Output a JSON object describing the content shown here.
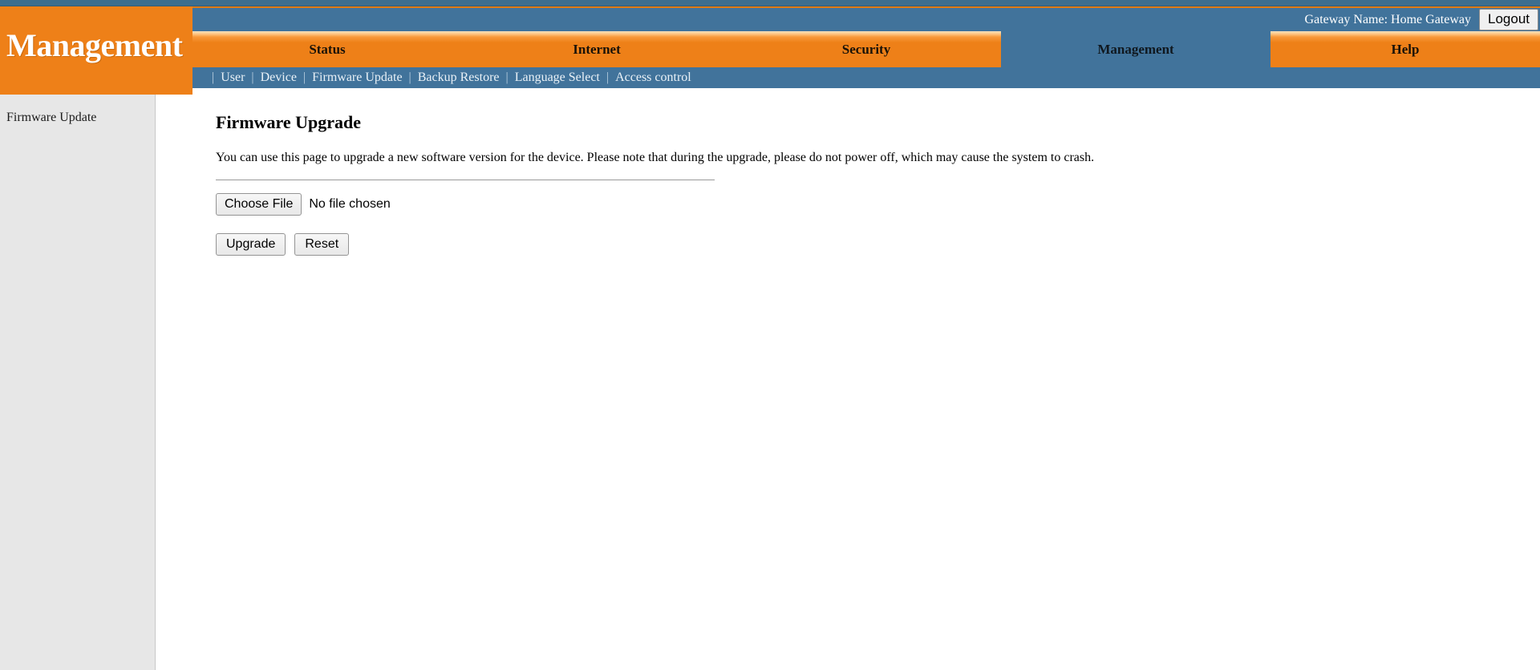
{
  "brand": {
    "title": "Management"
  },
  "header": {
    "gateway_label": "Gateway Name: Home Gateway",
    "logout_label": "Logout"
  },
  "main_nav": {
    "tabs": [
      {
        "label": "Status",
        "active": false
      },
      {
        "label": "Internet",
        "active": false
      },
      {
        "label": "Security",
        "active": false
      },
      {
        "label": "Management",
        "active": true
      },
      {
        "label": "Help",
        "active": false
      }
    ]
  },
  "sub_nav": {
    "separator": "|",
    "items": [
      {
        "label": "User"
      },
      {
        "label": "Device"
      },
      {
        "label": "Firmware Update"
      },
      {
        "label": "Backup Restore"
      },
      {
        "label": "Language Select"
      },
      {
        "label": "Access control"
      }
    ]
  },
  "sidebar": {
    "items": [
      {
        "label": "Firmware Update"
      }
    ]
  },
  "main": {
    "title": "Firmware Upgrade",
    "description": "You can use this page to upgrade a new software version for the device. Please note that during the upgrade, please do not power off, which may cause the system to crash.",
    "file_input": {
      "button_label": "Choose File",
      "status_text": "No file chosen"
    },
    "actions": [
      {
        "label": "Upgrade"
      },
      {
        "label": "Reset"
      }
    ]
  },
  "colors": {
    "brand_orange": "#ee8018",
    "steel_blue": "#41739b",
    "top_strip_blue": "#3c6e8f",
    "sidebar_gray": "#e7e7e7"
  }
}
